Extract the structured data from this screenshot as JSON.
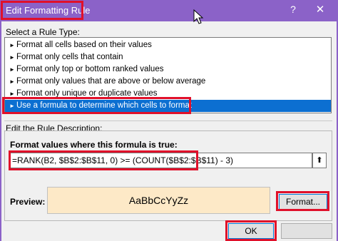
{
  "window": {
    "title": "Edit Formatting Rule",
    "help_glyph": "?",
    "close_glyph": "✕"
  },
  "rule_type": {
    "label": "Select a Rule Type:",
    "items": [
      "Format all cells based on their values",
      "Format only cells that contain",
      "Format only top or bottom ranked values",
      "Format only values that are above or below average",
      "Format only unique or duplicate values",
      "Use a formula to determine which cells to format"
    ],
    "selected_index": 5
  },
  "description": {
    "label": "Edit the Rule Description:",
    "formula_label": "Format values where this formula is true:",
    "formula_value": "=RANK(B2, $B$2:$B$11, 0) >= (COUNT($B$2:$B$11) - 3)",
    "collapse_glyph": "⬆"
  },
  "preview": {
    "label": "Preview:",
    "sample_text": "AaBbCcYyZz",
    "background": "#fde9c7"
  },
  "buttons": {
    "format": "Format...",
    "ok": "OK",
    "cancel": ""
  },
  "colors": {
    "titlebar": "#8b62c8",
    "selection": "#0c6fd1",
    "highlight": "#e0102a"
  }
}
